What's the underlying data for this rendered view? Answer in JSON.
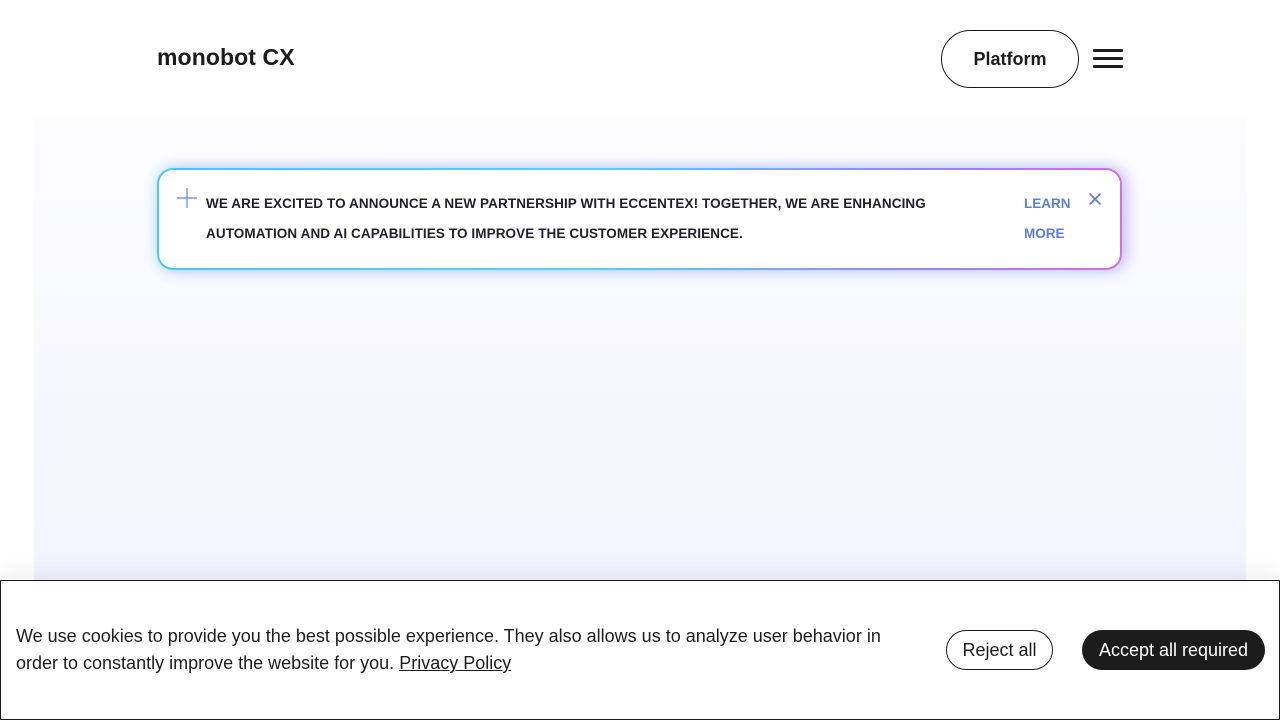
{
  "header": {
    "logo": "monobot CX",
    "platform_label": "Platform",
    "menu_icon": "hamburger-menu-icon"
  },
  "announcement": {
    "icon": "sparkle-icon",
    "text": "WE ARE EXCITED TO ANNOUNCE A NEW PARTNERSHIP WITH ECCENTEX! TOGETHER, WE ARE ENHANCING AUTOMATION AND AI CAPABILITIES TO IMPROVE THE CUSTOMER EXPERIENCE.",
    "link_label": "LEARN MORE",
    "close_icon": "close-icon",
    "link_color": "#5b7fd6",
    "border_gradient": [
      "#4cc6f2",
      "#56d2f2",
      "#9a86e6",
      "#d76ee0"
    ]
  },
  "cookie_banner": {
    "text": "We use cookies to provide you the best possible experience. They also allows us to analyze user behavior in order to constantly improve the website for you.",
    "privacy_link": "Privacy Policy",
    "reject_label": "Reject all",
    "accept_label": "Accept all required"
  },
  "colors": {
    "text": "#1c1c1c",
    "background": "#ffffff",
    "accept_button_bg": "#1c1c1c"
  }
}
